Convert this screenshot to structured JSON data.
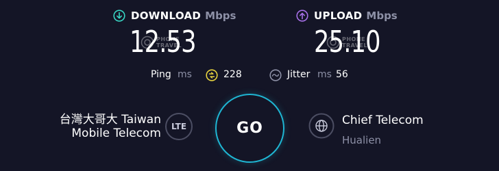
{
  "download": {
    "label": "DOWNLOAD",
    "unit": "Mbps",
    "value": "12.53",
    "icon": "arrow-down-circle-icon",
    "icon_color": "#38d6c4"
  },
  "upload": {
    "label": "UPLOAD",
    "unit": "Mbps",
    "value": "25.10",
    "icon": "arrow-up-circle-icon",
    "icon_color": "#a770e8"
  },
  "ping": {
    "label": "Ping",
    "unit": "ms",
    "value": "228",
    "icon": "ping-gauge-icon",
    "icon_color": "#e8d33f"
  },
  "jitter": {
    "label": "Jitter",
    "unit": "ms",
    "value": "56",
    "icon": "jitter-wave-icon"
  },
  "provider": {
    "name_line1": "台灣大哥大 Taiwan",
    "name_line2": "Mobile Telecom",
    "badge": "LTE"
  },
  "go_button": {
    "label": "GO",
    "ring_color": "#1fb6d3"
  },
  "server": {
    "name": "Chief Telecom",
    "location": "Hualien",
    "icon": "globe-icon"
  },
  "watermark": {
    "line1": "PHONE",
    "line2": "TRAVEL"
  },
  "colors": {
    "background": "#141526",
    "muted_text": "#8d90a6"
  }
}
